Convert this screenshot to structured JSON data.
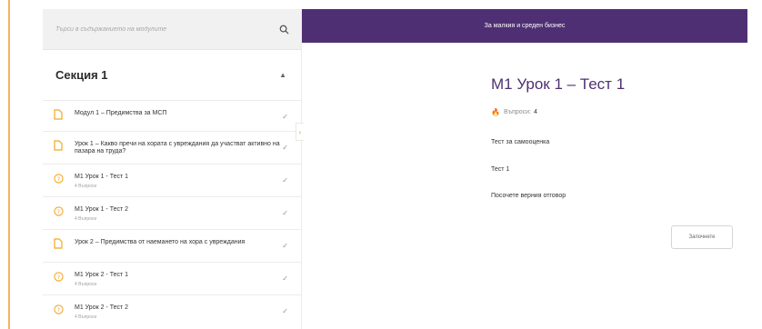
{
  "colors": {
    "accent": "#f4a623",
    "brand_purple": "#4f2f73",
    "left_accent_line": "#f7b35b"
  },
  "search": {
    "placeholder": "Търси в съдържанието на модулите"
  },
  "header": {
    "title": "За малкия и среден бизнес"
  },
  "sidebar": {
    "section_title": "Секция 1",
    "items": [
      {
        "type": "lesson",
        "icon": "document-icon",
        "title": "Модул 1 – Предимства за МСП",
        "subtitle": ""
      },
      {
        "type": "lesson",
        "icon": "document-icon",
        "title": "Урок 1 – Какво пречи на хората с увреждания да участват активно на пазара на труда?",
        "subtitle": ""
      },
      {
        "type": "quiz",
        "icon": "question-icon",
        "title": "М1 Урок 1 - Тест 1",
        "subtitle": "4 Въпроси"
      },
      {
        "type": "quiz",
        "icon": "question-icon",
        "title": "М1 Урок 1 - Тест 2",
        "subtitle": "4 Въпроси"
      },
      {
        "type": "lesson",
        "icon": "document-icon",
        "title": "Урок 2 – Предимства от наемането на хора с увреждания",
        "subtitle": ""
      },
      {
        "type": "quiz",
        "icon": "question-icon",
        "title": "М1 Урок 2 - Тест 1",
        "subtitle": "4 Въпроси"
      },
      {
        "type": "quiz",
        "icon": "question-icon",
        "title": "М1 Урок 2 - Тест 2",
        "subtitle": "4 Въпроси"
      }
    ]
  },
  "main": {
    "title": "М1 Урок 1 – Тест 1",
    "questions_label": "Въпроси:",
    "questions_count": "4",
    "line1": "Тест за самооценка",
    "line2": "Тест 1",
    "line3": "Посочете верния отговор",
    "start_button": "Започнете"
  }
}
